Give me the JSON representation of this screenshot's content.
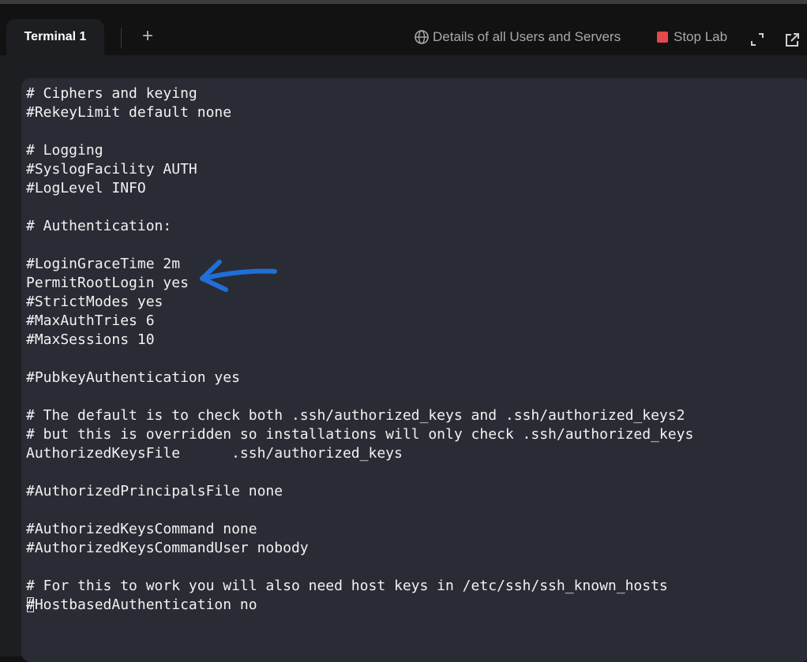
{
  "tabs": {
    "active_label": "Terminal 1",
    "add_label": "+"
  },
  "toolbar": {
    "details_label": "Details of all Users and Servers",
    "stop_label": "Stop Lab",
    "stop_color": "#e5484d"
  },
  "icons": {
    "details": "globe-icon",
    "expand": "expand-icon",
    "popout": "external-link-icon"
  },
  "annotation": {
    "type": "hand-drawn-arrow",
    "color": "#1f6fd6",
    "points_to": "PermitRootLogin yes"
  },
  "terminal": {
    "lines": [
      "# Ciphers and keying",
      "#RekeyLimit default none",
      "",
      "# Logging",
      "#SyslogFacility AUTH",
      "#LogLevel INFO",
      "",
      "# Authentication:",
      "",
      "#LoginGraceTime 2m",
      "PermitRootLogin yes",
      "#StrictModes yes",
      "#MaxAuthTries 6",
      "#MaxSessions 10",
      "",
      "#PubkeyAuthentication yes",
      "",
      "# The default is to check both .ssh/authorized_keys and .ssh/authorized_keys2",
      "# but this is overridden so installations will only check .ssh/authorized_keys",
      "AuthorizedKeysFile      .ssh/authorized_keys",
      "",
      "#AuthorizedPrincipalsFile none",
      "",
      "#AuthorizedKeysCommand none",
      "#AuthorizedKeysCommandUser nobody",
      "",
      "# For this to work you will also need host keys in /etc/ssh/ssh_known_hosts"
    ],
    "cursor_line": {
      "cursor_char": "#",
      "rest": "HostbasedAuthentication no"
    }
  }
}
